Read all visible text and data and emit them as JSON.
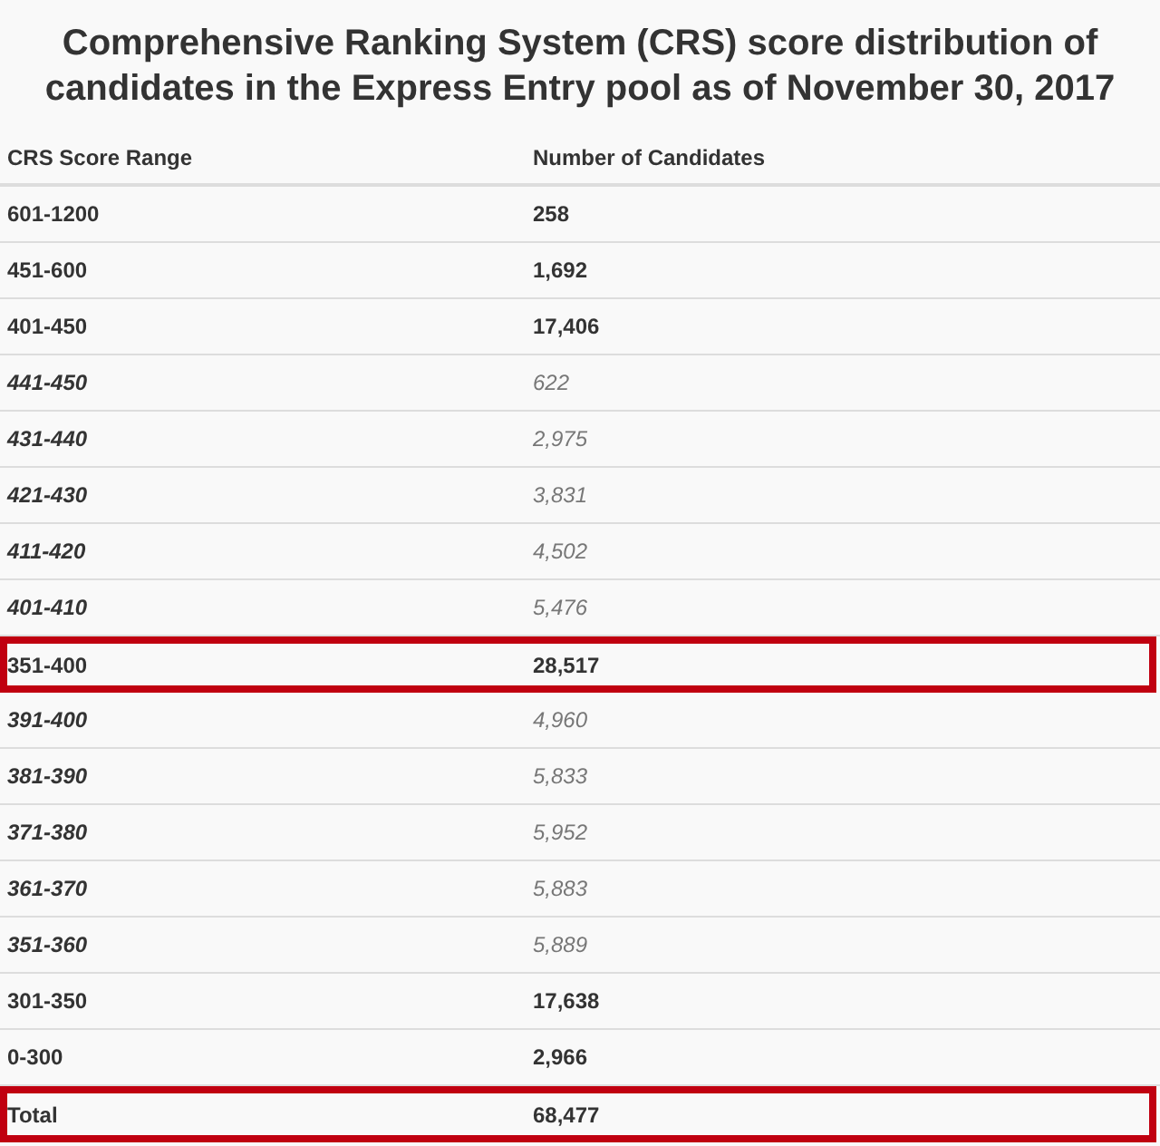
{
  "title": "Comprehensive Ranking System (CRS) score distribution of candidates in the Express Entry pool as of November 30, 2017",
  "columns": [
    "CRS Score Range",
    "Number of Candidates"
  ],
  "rows": [
    {
      "kind": "main",
      "range": "601-1200",
      "count": "258",
      "highlighted": false
    },
    {
      "kind": "main",
      "range": "451-600",
      "count": "1,692",
      "highlighted": false
    },
    {
      "kind": "main",
      "range": "401-450",
      "count": "17,406",
      "highlighted": false
    },
    {
      "kind": "sub",
      "range": "441-450",
      "count": "622",
      "highlighted": false
    },
    {
      "kind": "sub",
      "range": "431-440",
      "count": "2,975",
      "highlighted": false
    },
    {
      "kind": "sub",
      "range": "421-430",
      "count": "3,831",
      "highlighted": false
    },
    {
      "kind": "sub",
      "range": "411-420",
      "count": "4,502",
      "highlighted": false
    },
    {
      "kind": "sub",
      "range": "401-410",
      "count": "5,476",
      "highlighted": false
    },
    {
      "kind": "main",
      "range": "351-400",
      "count": "28,517",
      "highlighted": true
    },
    {
      "kind": "sub",
      "range": "391-400",
      "count": "4,960",
      "highlighted": false
    },
    {
      "kind": "sub",
      "range": "381-390",
      "count": "5,833",
      "highlighted": false
    },
    {
      "kind": "sub",
      "range": "371-380",
      "count": "5,952",
      "highlighted": false
    },
    {
      "kind": "sub",
      "range": "361-370",
      "count": "5,883",
      "highlighted": false
    },
    {
      "kind": "sub",
      "range": "351-360",
      "count": "5,889",
      "highlighted": false
    },
    {
      "kind": "main",
      "range": "301-350",
      "count": "17,638",
      "highlighted": false
    },
    {
      "kind": "main",
      "range": "0-300",
      "count": "2,966",
      "highlighted": false
    },
    {
      "kind": "main",
      "range": "Total",
      "count": "68,477",
      "highlighted": true
    }
  ]
}
